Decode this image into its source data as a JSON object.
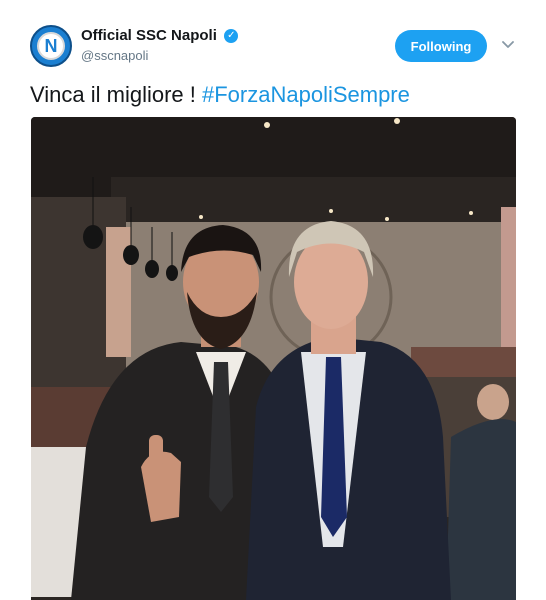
{
  "tweet": {
    "display_name": "Official SSC Napoli",
    "handle": "@sscnapoli",
    "avatar_letter": "N",
    "verified_icon": "verified-badge-icon",
    "follow_label": "Following",
    "text": "Vinca il migliore ! ",
    "hashtag": "#ForzaNapoliSempre",
    "media": {
      "alt": "Photo of two men in suits in a restaurant, one giving a thumbs up"
    }
  },
  "colors": {
    "accent": "#1da1f2",
    "link": "#1b95e0",
    "secondary_text": "#657786",
    "avatar_blue": "#1b7fd1"
  }
}
